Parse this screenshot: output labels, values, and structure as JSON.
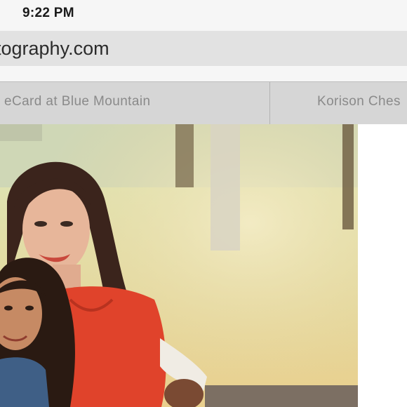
{
  "status_bar": {
    "time": "9:22 PM"
  },
  "address_bar": {
    "url": "tography.com"
  },
  "tabs": [
    {
      "label": "eCard at Blue Mountain"
    },
    {
      "label": "Korison Ches"
    }
  ],
  "photo": {
    "description_icon": "photo"
  }
}
